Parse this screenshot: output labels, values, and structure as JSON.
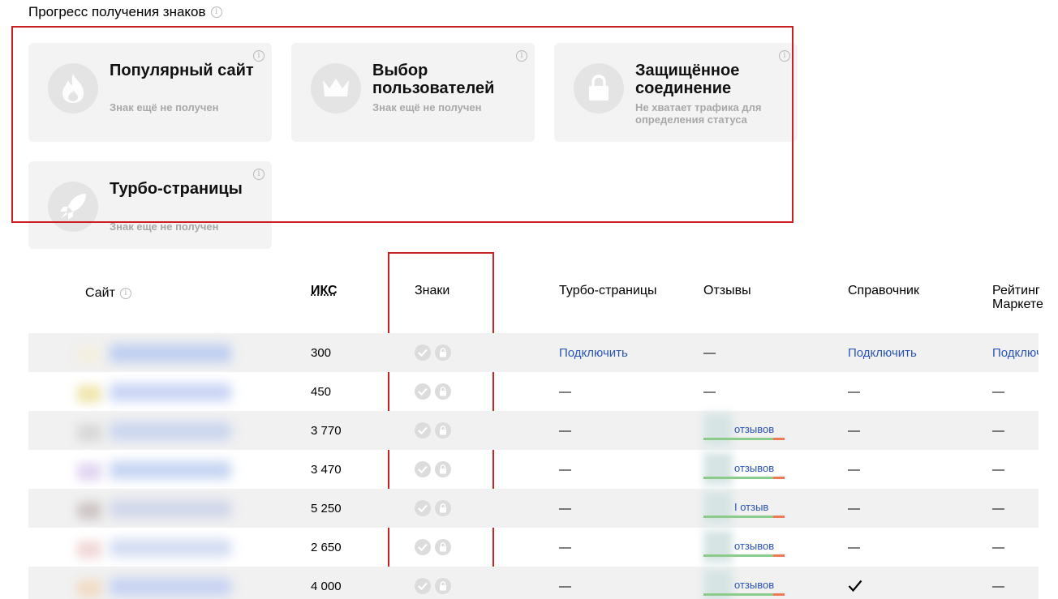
{
  "progress": {
    "title": "Прогресс получения знаков",
    "cards": [
      {
        "title": "Популярный сайт",
        "status": "Знак ещё не получен",
        "icon": "flame-icon"
      },
      {
        "title": "Выбор пользователей",
        "status": "Знак ещё не получен",
        "icon": "crown-icon"
      },
      {
        "title": "Защищённое соединение",
        "status": "Не хватает трафика для определения статуса",
        "icon": "lock-icon"
      },
      {
        "title": "Турбо-страницы",
        "status": "Знак еще не получен",
        "icon": "rocket-icon"
      }
    ]
  },
  "table": {
    "headers": {
      "site": "Сайт",
      "iks": "ИКС",
      "badges": "Знаки",
      "turbo": "Турбо-страницы",
      "reviews": "Отзывы",
      "directory": "Справочник",
      "market": "Рейтинг Маркете"
    },
    "rows": [
      {
        "iks": "300",
        "turbo": "Подключить",
        "reviews": "—",
        "directory": "Подключить",
        "market": "Подключ"
      },
      {
        "iks": "450",
        "turbo": "—",
        "reviews": "—",
        "directory": "—",
        "market": "—"
      },
      {
        "iks": "3 770",
        "turbo": "—",
        "reviews": "отзывов",
        "directory": "—",
        "market": "—"
      },
      {
        "iks": "3 470",
        "turbo": "—",
        "reviews": "отзывов",
        "directory": "—",
        "market": "—"
      },
      {
        "iks": "5 250",
        "turbo": "—",
        "reviews": "I отзыв",
        "directory": "—",
        "market": "—"
      },
      {
        "iks": "2 650",
        "turbo": "—",
        "reviews": "отзывов",
        "directory": "—",
        "market": "—"
      },
      {
        "iks": "4 000",
        "turbo": "—",
        "reviews": "отзывов",
        "directory": "✓",
        "market": "—"
      }
    ]
  },
  "colors": {
    "highlight": "#cc1f1f",
    "link": "#2a55b5",
    "card_bg": "#f3f3f3",
    "row_shade": "#f1f1f1",
    "rating_good": "#8bcc8b",
    "rating_bad": "#f07855"
  }
}
